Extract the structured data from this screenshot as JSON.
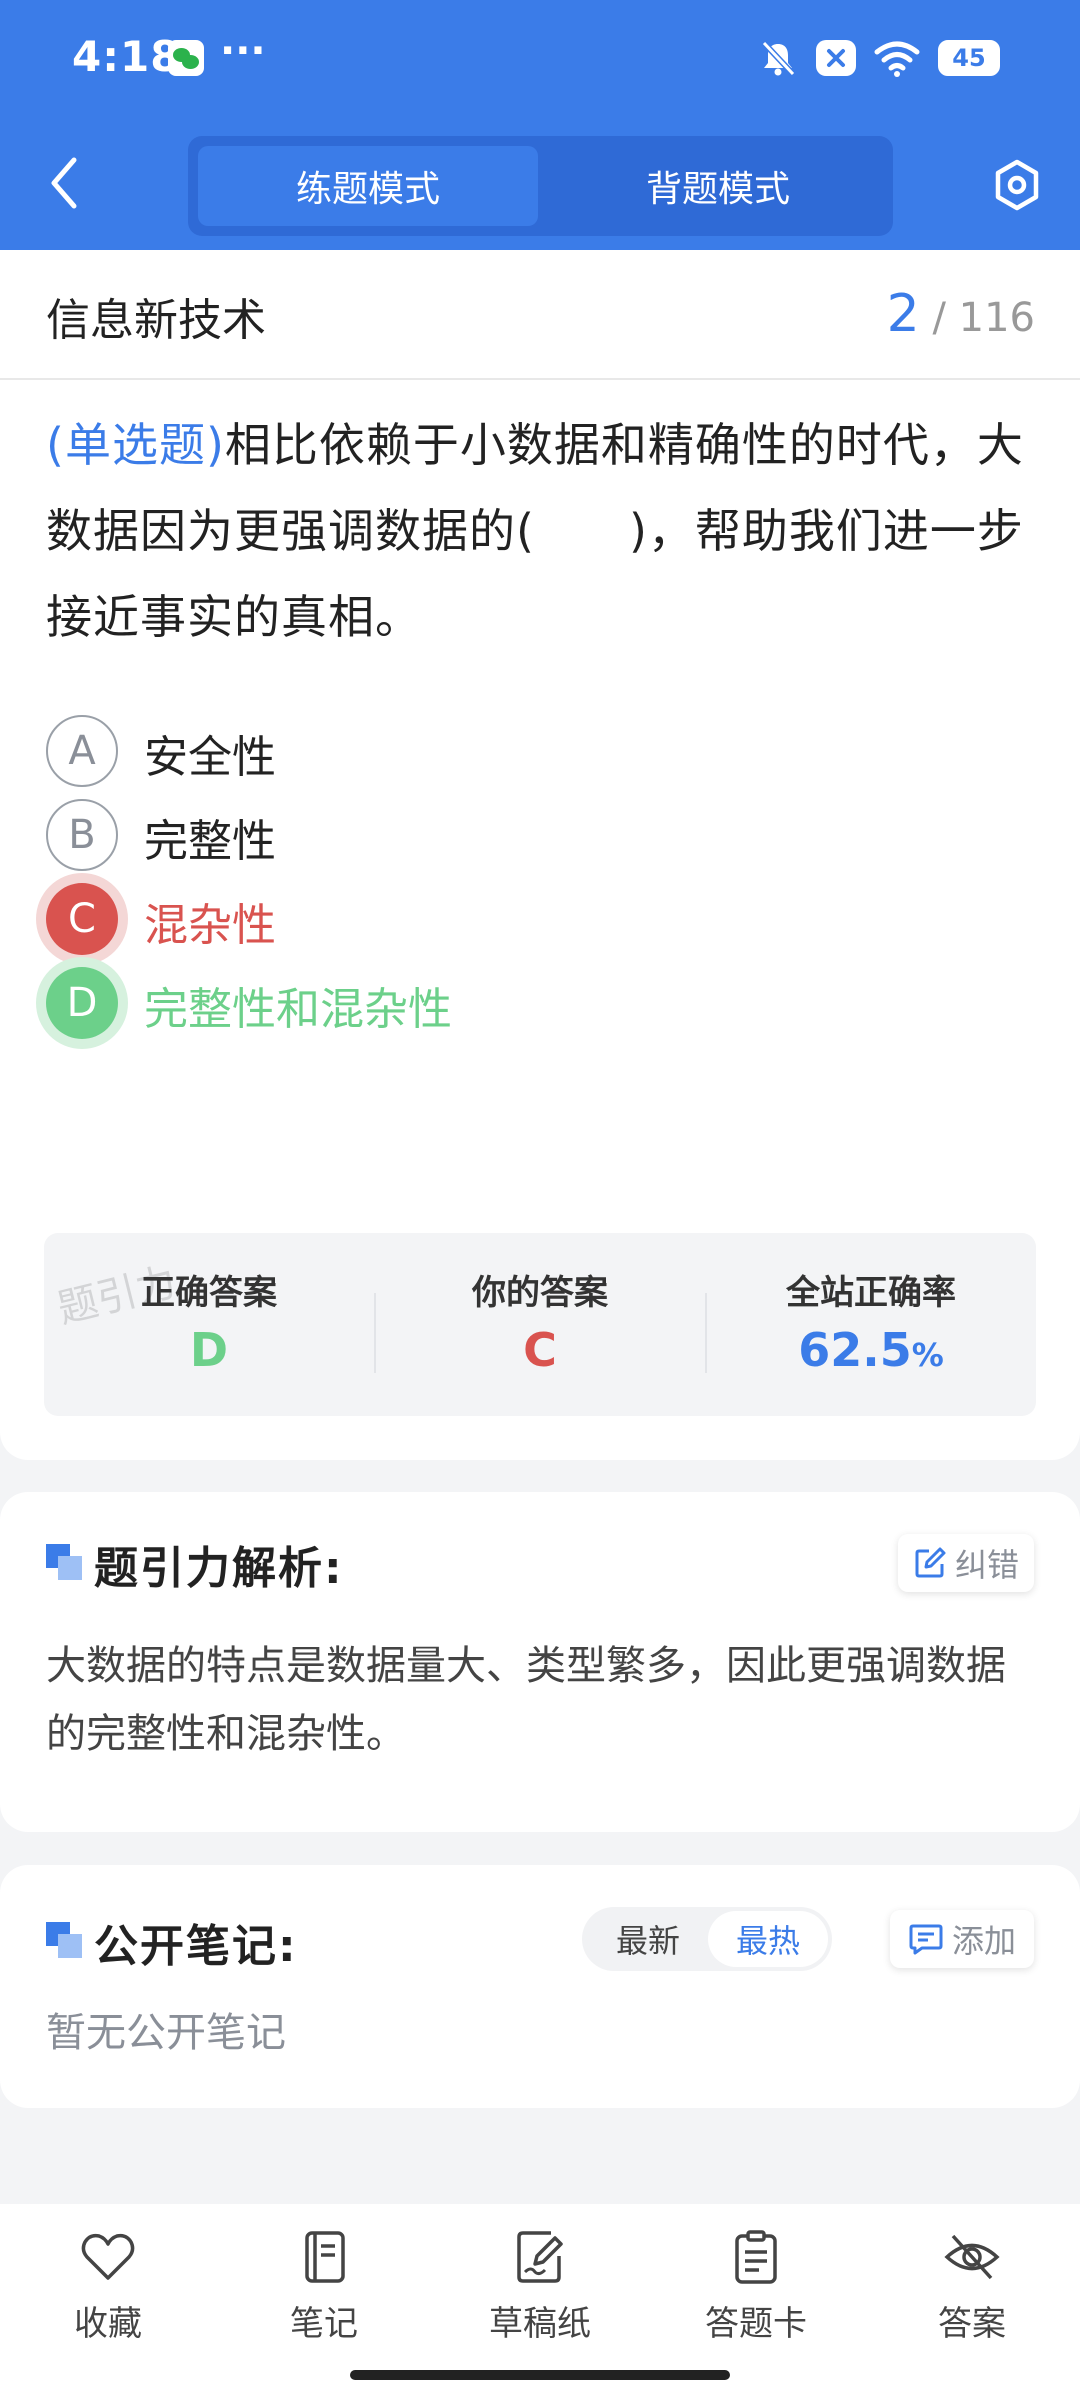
{
  "status_bar": {
    "time": "4:18",
    "more": "···",
    "battery": "45"
  },
  "header": {
    "tabs": [
      "练题模式",
      "背题模式"
    ],
    "active_tab": 0
  },
  "topic": {
    "title": "信息新技术",
    "current": "2",
    "total": "/ 116"
  },
  "question": {
    "type": "(单选题)",
    "text": "相比依赖于小数据和精确性的时代，大数据因为更强调数据的(　　)，帮助我们进一步接近事实的真相。"
  },
  "options": [
    {
      "letter": "A",
      "text": "安全性",
      "state": "normal"
    },
    {
      "letter": "B",
      "text": "完整性",
      "state": "normal"
    },
    {
      "letter": "C",
      "text": "混杂性",
      "state": "wrong"
    },
    {
      "letter": "D",
      "text": "完整性和混杂性",
      "state": "correct"
    }
  ],
  "result": {
    "correct_label": "正确答案",
    "correct_value": "D",
    "yours_label": "你的答案",
    "yours_value": "C",
    "rate_label": "全站正确率",
    "rate_value": "62.5",
    "rate_unit": "%",
    "watermark": "题引力"
  },
  "analysis": {
    "title": "题引力解析:",
    "report_label": "纠错",
    "text": "大数据的特点是数据量大、类型繁多，因此更强调数据的完整性和混杂性。"
  },
  "notes": {
    "title": "公开笔记:",
    "sort_options": [
      "最新",
      "最热"
    ],
    "active_sort": 1,
    "add_label": "添加",
    "empty_text": "暂无公开笔记"
  },
  "bottom_tabs": [
    "收藏",
    "笔记",
    "草稿纸",
    "答题卡",
    "答案"
  ],
  "colors": {
    "primary": "#3b7ce8",
    "wrong": "#d9534f",
    "correct": "#6cd08a"
  }
}
